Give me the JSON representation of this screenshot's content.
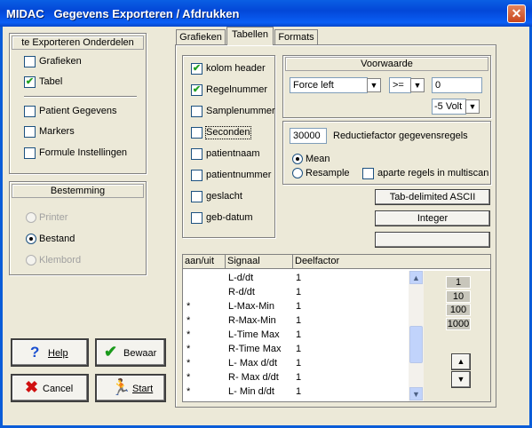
{
  "window": {
    "title": "MIDAC   Gegevens Exporteren / Afdrukken",
    "close_label": "✕"
  },
  "left_panel": {
    "title": "te Exporteren Onderdelen",
    "items_top": [
      {
        "label": "Grafieken",
        "checked": false
      },
      {
        "label": "Tabel",
        "checked": true
      }
    ],
    "items_bottom": [
      {
        "label": "Patient Gegevens",
        "checked": false
      },
      {
        "label": "Markers",
        "checked": false
      },
      {
        "label": "Formule Instellingen",
        "checked": false
      }
    ]
  },
  "bestemming": {
    "title": "Bestemming",
    "options": [
      {
        "label": "Printer",
        "selected": false,
        "enabled": false
      },
      {
        "label": "Bestand",
        "selected": true,
        "enabled": true
      },
      {
        "label": "Klembord",
        "selected": false,
        "enabled": false
      }
    ]
  },
  "buttons": {
    "help": "Help",
    "bewaar": "Bewaar",
    "cancel": "Cancel",
    "start": "Start"
  },
  "tabs": [
    {
      "label": "Grafieken"
    },
    {
      "label": "Tabellen",
      "active": true
    },
    {
      "label": "Formats"
    }
  ],
  "columns": [
    {
      "label": "kolom header",
      "checked": true
    },
    {
      "label": "Regelnummer",
      "checked": true
    },
    {
      "label": "Samplenummer",
      "checked": false
    },
    {
      "label": "Seconden",
      "checked": false
    },
    {
      "label": "patientnaam",
      "checked": false
    },
    {
      "label": "patientnummer",
      "checked": false
    },
    {
      "label": "geslacht",
      "checked": false
    },
    {
      "label": "geb-datum",
      "checked": false
    }
  ],
  "voorwaarde": {
    "title": "Voorwaarde",
    "mode": "Force left",
    "operator": ">=",
    "value": "0",
    "unit": "-5 Volt"
  },
  "reductie": {
    "value": "30000",
    "label": "Reductiefactor gegevensregels",
    "options": [
      {
        "label": "Mean",
        "selected": true
      },
      {
        "label": "Resample",
        "selected": false
      }
    ],
    "multiscan_label": "aparte regels in multiscan",
    "multiscan_checked": false
  },
  "format_buttons": [
    "Tab-delimited ASCII",
    "Integer",
    ""
  ],
  "table": {
    "headers": [
      "aan/uit",
      "Signaal",
      "Deelfactor"
    ],
    "rows": [
      {
        "on": "",
        "signal": "L-d/dt",
        "factor": "1"
      },
      {
        "on": "",
        "signal": "R-d/dt",
        "factor": "1"
      },
      {
        "on": "*",
        "signal": "L-Max-Min",
        "factor": "1"
      },
      {
        "on": "*",
        "signal": "R-Max-Min",
        "factor": "1"
      },
      {
        "on": "*",
        "signal": "L-Time Max",
        "factor": "1"
      },
      {
        "on": "*",
        "signal": "R-Time Max",
        "factor": "1"
      },
      {
        "on": "*",
        "signal": "L- Max d/dt",
        "factor": "1"
      },
      {
        "on": "*",
        "signal": "R- Max d/dt",
        "factor": "1"
      },
      {
        "on": "*",
        "signal": "L- Min d/dt",
        "factor": "1"
      }
    ]
  },
  "factor_buttons": [
    "1",
    "10",
    "100",
    "1000"
  ],
  "arrows": {
    "up": "▲",
    "down": "▼"
  },
  "colors": {
    "titlebar": "#0a5fe4",
    "dialog": "#ece9d8",
    "check": "#21a121"
  }
}
